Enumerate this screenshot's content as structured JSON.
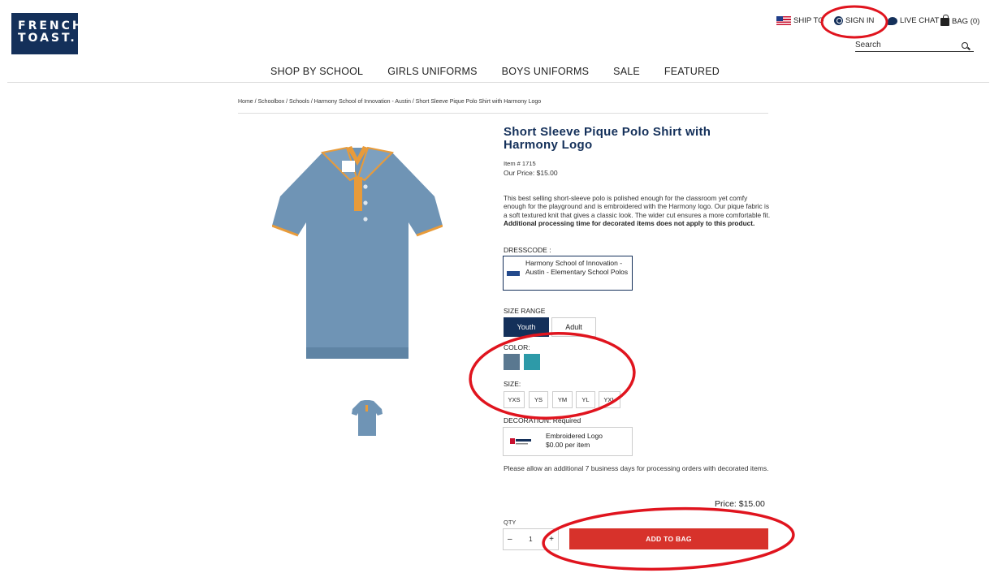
{
  "brand": {
    "line1": "FRENCH",
    "line2": "TOAST."
  },
  "utility": {
    "ship_to": "SHIP TO",
    "sign_in": "SIGN IN",
    "live_chat": "LIVE CHAT",
    "bag": "BAG (0)"
  },
  "search": {
    "placeholder": "Search"
  },
  "nav": [
    "SHOP BY SCHOOL",
    "GIRLS UNIFORMS",
    "BOYS UNIFORMS",
    "SALE",
    "FEATURED"
  ],
  "breadcrumb": "Home / Schoolbox / Schools / Harmony School of Innovation - Austin / Short Sleeve Pique Polo Shirt with Harmony Logo",
  "product": {
    "title": "Short Sleeve Pique Polo Shirt with Harmony Logo",
    "item_no": "Item # 1715",
    "our_price": "Our Price: $15.00",
    "description": "This best selling short-sleeve polo is polished enough for the classroom yet comfy enough for the playground and is embroidered with the Harmony logo. Our pique fabric is a soft textured knit that gives a classic look. The wider cut ensures a more comfortable fit.",
    "description_bold": "Additional processing time for decorated items does not apply to this product."
  },
  "dresscode": {
    "label": "DRESSCODE :",
    "value": "Harmony School of Innovation - Austin - Elementary School Polos"
  },
  "size_range": {
    "label": "SIZE RANGE",
    "options": [
      "Youth",
      "Adult"
    ],
    "selected": "Youth"
  },
  "color": {
    "label": "COLOR:",
    "swatches": [
      "#5a7890",
      "#2d9aa8"
    ]
  },
  "size": {
    "label": "SIZE:",
    "options": [
      "YXS",
      "YS",
      "YM",
      "YL",
      "YXL"
    ]
  },
  "decoration": {
    "label": "DECORATION: Required",
    "name": "Embroidered Logo",
    "price": "$0.00 per item"
  },
  "processing_note": "Please allow an additional 7 business days for processing orders with decorated items.",
  "total": "Price: $15.00",
  "qty": {
    "label": "QTY",
    "value": "1",
    "minus": "–",
    "plus": "+"
  },
  "add_to_bag": "ADD TO BAG",
  "colors": {
    "navy": "#14305a",
    "red": "#d7322b",
    "annotation": "#e0141e"
  }
}
